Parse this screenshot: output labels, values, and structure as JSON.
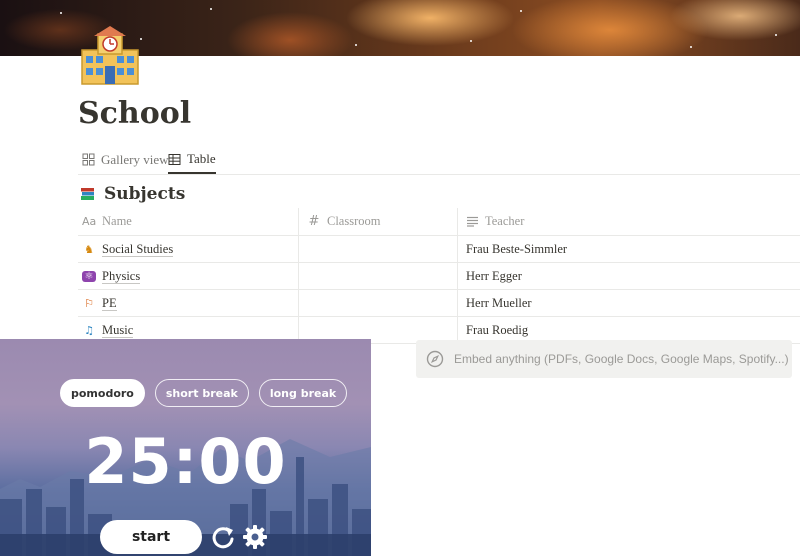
{
  "page": {
    "title": "School",
    "icon": "school-building-icon"
  },
  "tabs": [
    {
      "label": "Gallery view",
      "icon": "gallery-grid-icon",
      "active": false
    },
    {
      "label": "Table",
      "icon": "table-icon",
      "active": true
    }
  ],
  "database": {
    "title": "Subjects",
    "icon": "books-icon",
    "columns": [
      {
        "label": "Name",
        "icon": "text-property-icon"
      },
      {
        "label": "Classroom",
        "icon": "number-property-icon"
      },
      {
        "label": "Teacher",
        "icon": "text-lines-property-icon"
      }
    ],
    "rows": [
      {
        "name": "Social Studies",
        "icon": "people-icon",
        "classroom": "",
        "teacher": "Frau Beste-Simmler"
      },
      {
        "name": "Physics",
        "icon": "atom-icon",
        "classroom": "",
        "teacher": "Herr Egger"
      },
      {
        "name": "PE",
        "icon": "running-person-icon",
        "classroom": "",
        "teacher": "Herr Mueller"
      },
      {
        "name": "Music",
        "icon": "music-notes-icon",
        "classroom": "",
        "teacher": "Frau Roedig"
      }
    ]
  },
  "embed": {
    "placeholder": "Embed anything (PDFs, Google Docs, Google Maps, Spotify...)",
    "icon": "compass-icon"
  },
  "timer": {
    "modes": [
      "pomodoro",
      "short break",
      "long break"
    ],
    "active_mode": "pomodoro",
    "time": "25:00",
    "start_label": "start",
    "icons": [
      "restart-icon",
      "gear-icon"
    ]
  },
  "colors": {
    "text": "#37352f",
    "muted": "#9b9a97",
    "border": "#e9e9e7",
    "embed_bg": "#f1f1ef"
  }
}
